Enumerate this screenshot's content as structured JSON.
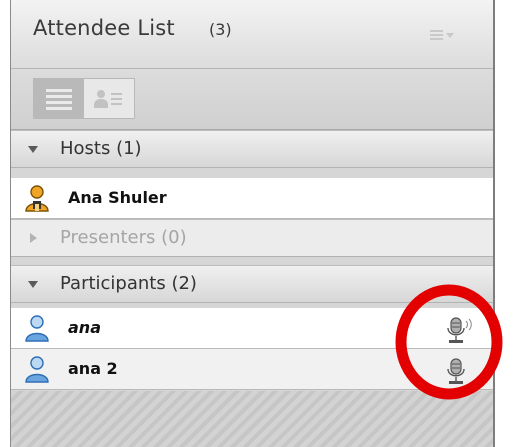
{
  "panel": {
    "title": "Attendee List",
    "count": "(3)"
  },
  "sections": {
    "hosts": {
      "label": "Hosts (1)",
      "expanded": true
    },
    "presenters": {
      "label": "Presenters (0)",
      "expanded": false
    },
    "participants": {
      "label": "Participants (2)",
      "expanded": true
    }
  },
  "attendees": [
    {
      "name": "Ana Shuler",
      "role": "host",
      "icon": "host-avatar-icon"
    },
    {
      "name": "ana",
      "role": "participant",
      "icon": "participant-avatar-icon",
      "audio": "speaking"
    },
    {
      "name": "ana 2",
      "role": "participant",
      "icon": "participant-avatar-icon",
      "audio": "mic-on"
    }
  ],
  "colors": {
    "highlight_ring": "#e30000",
    "participant_avatar": "#6aa5e0",
    "host_avatar": "#f0a624"
  }
}
